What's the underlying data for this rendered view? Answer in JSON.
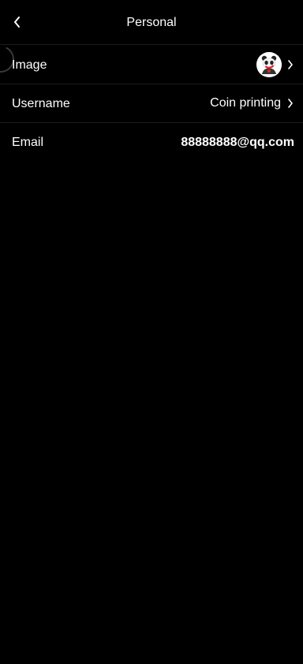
{
  "header": {
    "title": "Personal",
    "back_icon": "chevron-left-icon"
  },
  "rows": {
    "image": {
      "label": "Image",
      "value_icon": "panda-avatar",
      "chevron_icon": "chevron-right-icon"
    },
    "username": {
      "label": "Username",
      "value": "Coin printing",
      "chevron_icon": "chevron-right-icon"
    },
    "email": {
      "label": "Email",
      "value": "88888888@qq.com"
    }
  },
  "colors": {
    "background": "#000000",
    "text": "#ffffff",
    "divider": "#1c1c1c"
  }
}
